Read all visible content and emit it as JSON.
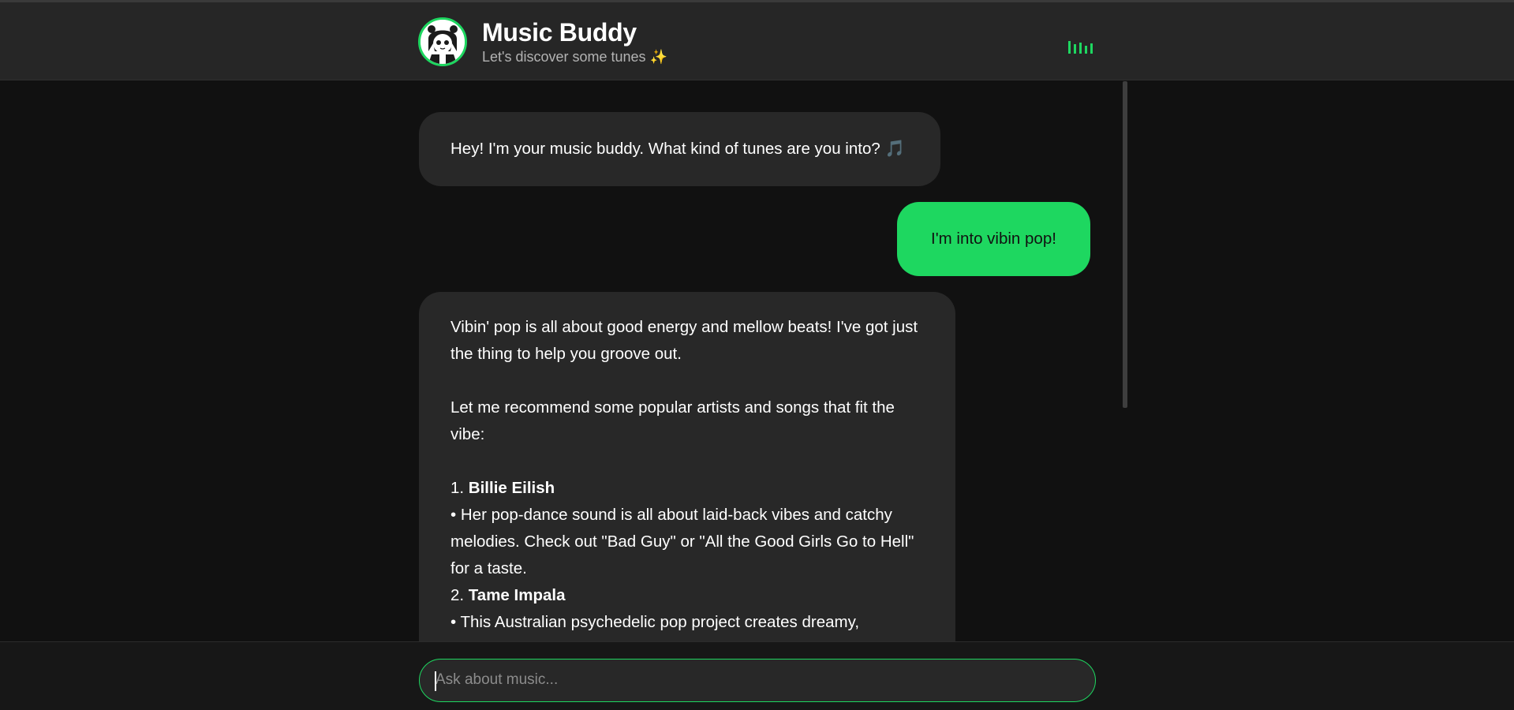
{
  "header": {
    "title": "Music Buddy",
    "subtitle": "Let's discover some tunes ✨"
  },
  "icons": {
    "avatar": "avatar-icon",
    "equalizer": "equalizer-icon",
    "music_note": "music-note-icon"
  },
  "colors": {
    "accent": "#1ed760",
    "background": "#111111",
    "header": "#262626",
    "bot_bubble": "#282828"
  },
  "messages": [
    {
      "role": "bot",
      "text": "Hey! I'm your music buddy. What kind of tunes are you into? ",
      "emoji": "🎵"
    },
    {
      "role": "user",
      "text": "I'm into vibin pop!"
    },
    {
      "role": "bot",
      "intro": "Vibin' pop is all about good energy and mellow beats! I've got just the thing to help you groove out.",
      "lead": "Let me recommend some popular artists and songs that fit the vibe:",
      "items": [
        {
          "number": "1. ",
          "artist": "Billie Eilish",
          "bullet": "• Her pop-dance sound is all about laid-back vibes and catchy melodies. Check out \"Bad Guy\" or \"All the Good Girls Go to Hell\" for a taste."
        },
        {
          "number": "2. ",
          "artist": "Tame Impala",
          "bullet": "• This Australian psychedelic pop project creates dreamy,"
        }
      ]
    }
  ],
  "input": {
    "placeholder": "Ask about music...",
    "value": ""
  }
}
